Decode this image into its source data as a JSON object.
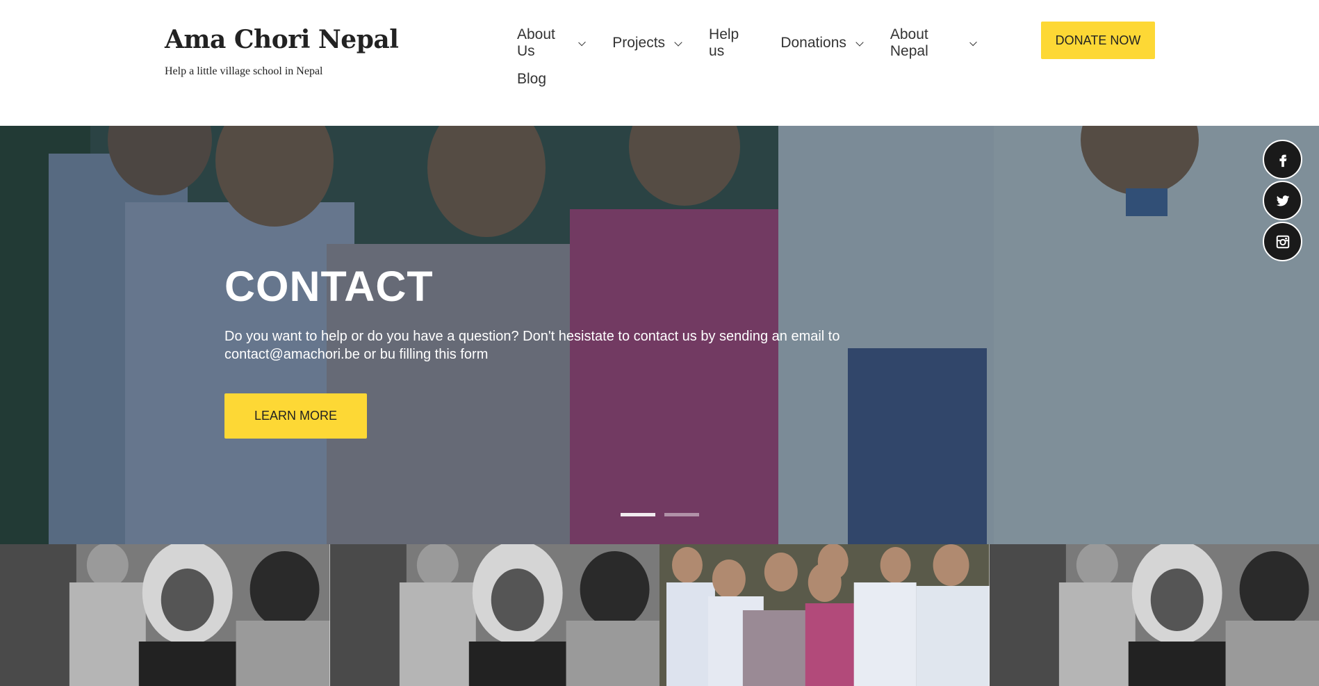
{
  "header": {
    "site_title": "Ama Chori Nepal",
    "tagline": "Help a little village school in Nepal",
    "nav": [
      {
        "label": "About Us",
        "has_dropdown": true
      },
      {
        "label": "Projects",
        "has_dropdown": true
      },
      {
        "label": "Help us",
        "has_dropdown": false
      },
      {
        "label": "Donations",
        "has_dropdown": true
      },
      {
        "label": "About Nepal",
        "has_dropdown": true
      },
      {
        "label": "Blog",
        "has_dropdown": false
      }
    ],
    "donate_label": "DONATE NOW"
  },
  "hero": {
    "title": "CONTACT",
    "text": "Do you want to help or do you have a question? Don't hesistate to contact us by sending an email to contact@amachori.be or bu filling this form",
    "button_label": "LEARN MORE",
    "slides_total": 2,
    "active_slide": 1
  },
  "social": {
    "icons": [
      "facebook-icon",
      "twitter-icon",
      "instagram-icon"
    ]
  },
  "gallery": {
    "tiles": [
      "bw-children-photo",
      "bw-children-photo",
      "schoolchildren-photo",
      "bw-children-photo"
    ]
  },
  "colors": {
    "accent": "#fdd835",
    "text": "#333333",
    "hero_overlay": "#142830"
  }
}
